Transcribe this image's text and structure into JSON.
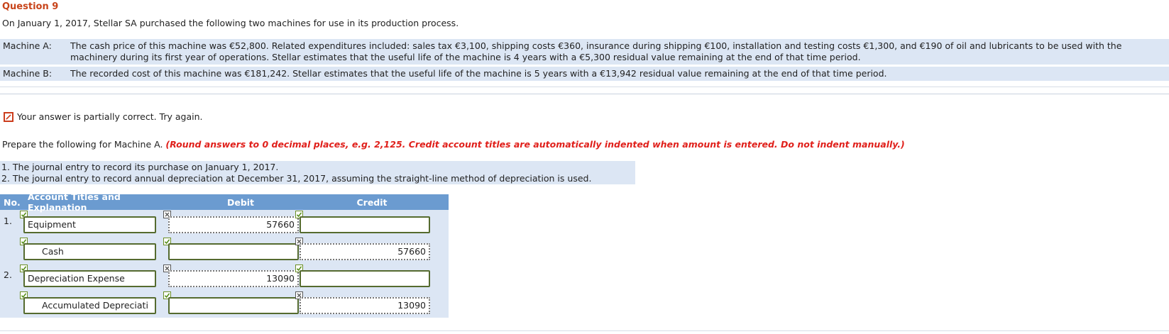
{
  "question": {
    "title": "Question 9",
    "intro": "On January 1, 2017, Stellar SA purchased the following two machines for use in its production process."
  },
  "machines": [
    {
      "label": "Machine A:",
      "text": "The cash price of this machine was €52,800. Related expenditures included: sales tax €3,100, shipping costs €360, insurance during shipping €100, installation and testing costs €1,300, and €190 of oil and lubricants to be used with the machinery during its first year of operations. Stellar estimates that the useful life of the machine is 4 years with a €5,300 residual value remaining at the end of that time period."
    },
    {
      "label": "Machine B:",
      "text": "The recorded cost of this machine was €181,242. Stellar estimates that the useful life of the machine is 5 years with a €13,942 residual value remaining at the end of that time period."
    }
  ],
  "status": {
    "message": "Your answer is partially correct.  Try again.",
    "icon": "pencil-icon",
    "color": "#cc3d1d"
  },
  "prepare": {
    "text": "Prepare the following for Machine A. ",
    "instruction": "(Round answers to 0 decimal places, e.g. 2,125. Credit account titles are automatically indented when amount is entered. Do not indent manually.)"
  },
  "tasks": [
    "1.  The journal entry to record its purchase on January 1, 2017.",
    "2.  The journal entry to record annual depreciation at December 31, 2017, assuming the straight-line method of depreciation is used."
  ],
  "journal": {
    "headers": {
      "no": "No.",
      "account": "Account Titles and Explanation",
      "debit": "Debit",
      "credit": "Credit"
    },
    "header_color": "#6b9bd0",
    "rows": [
      {
        "no": "1.",
        "account": "Equipment",
        "debit": "57660",
        "credit": "",
        "account_ok": true,
        "debit_ok": false,
        "credit_ok": true
      },
      {
        "no": "",
        "account": "Cash",
        "debit": "",
        "credit": "57660",
        "account_ok": true,
        "debit_ok": true,
        "credit_ok": false
      },
      {
        "no": "2.",
        "account": "Depreciation Expense",
        "debit": "13090",
        "credit": "",
        "account_ok": true,
        "debit_ok": false,
        "credit_ok": true
      },
      {
        "no": "",
        "account": "Accumulated Depreciati",
        "debit": "",
        "credit": "13090",
        "account_ok": true,
        "debit_ok": true,
        "credit_ok": false
      }
    ]
  }
}
